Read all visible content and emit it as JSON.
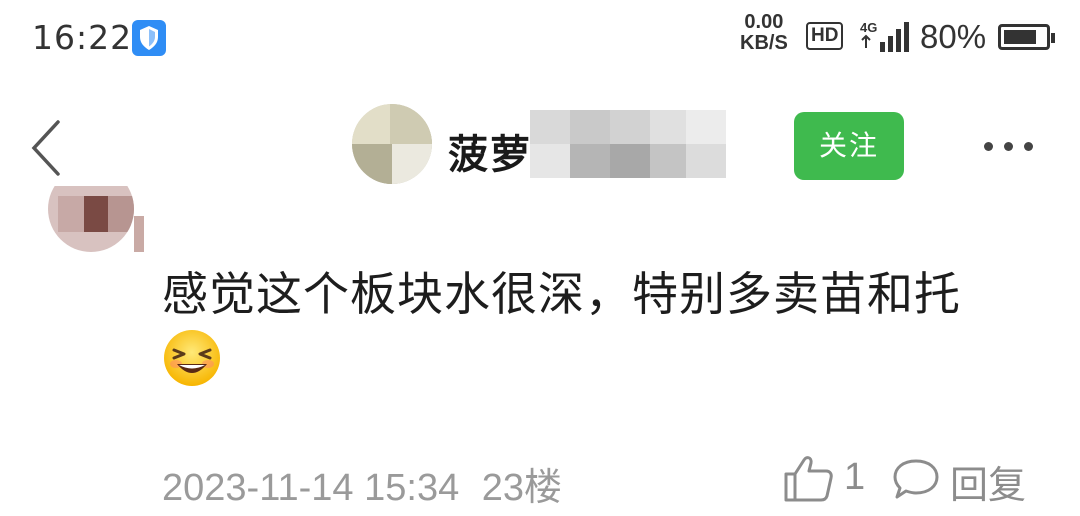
{
  "status_bar": {
    "time": "16:22",
    "net_speed_value": "0.00",
    "net_speed_unit": "KB/S",
    "hd_label": "HD",
    "network_type": "4G",
    "battery_percent": "80%",
    "battery_level": 0.8
  },
  "header": {
    "username_visible": "菠萝",
    "follow_label": "关注"
  },
  "comment": {
    "text": "感觉这个板块水很深，特别多卖苗和托",
    "emoji": "grinning-squinting-face-emoji",
    "date": "2023-11-14 15:34",
    "floor": "23楼",
    "like_count": "1",
    "reply_label": "回复"
  },
  "colors": {
    "follow_button": "#3fba4e",
    "meta_text": "#9a9a9a",
    "shield_icon": "#2f8df5"
  }
}
